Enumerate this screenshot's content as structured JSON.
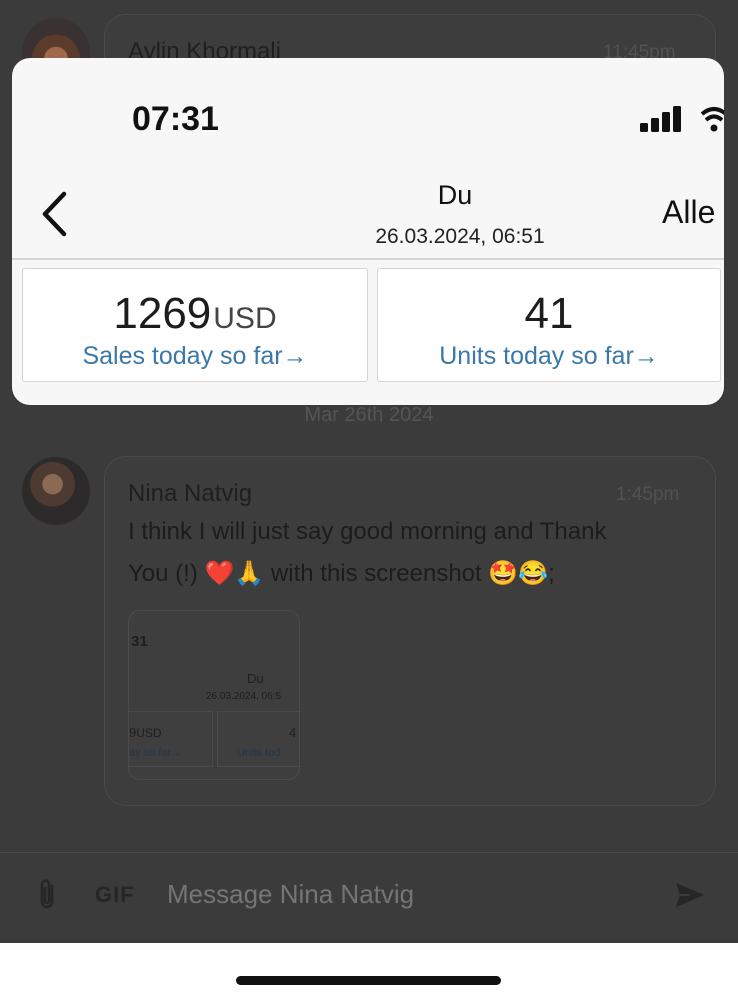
{
  "background_chat": {
    "top_message": {
      "sender": "Aylin Khormali",
      "time": "11:45pm"
    },
    "date_separator": "Mar 26th 2024",
    "message": {
      "sender": "Nina Natvig",
      "time": "1:45pm",
      "text_line1": "I think I will just say good morning and Thank",
      "text_line2": "You (!) ❤️🙏 with this screenshot 🤩😂;"
    },
    "thumbnail": {
      "time": "31",
      "title": "Du",
      "date": "26.03.2024, 06:5",
      "sales_value": "9",
      "sales_unit": "USD",
      "sales_label": "ay so far→",
      "units_value": "4",
      "units_label": "Units tod"
    },
    "composer": {
      "gif_label": "GIF",
      "placeholder": "Message Nina Natvig",
      "attach_icon": "paperclip-icon",
      "send_icon": "send-icon"
    }
  },
  "overlay_screenshot": {
    "status_time": "07:31",
    "title": "Du",
    "date": "26.03.2024, 06:51",
    "right_link": "Alle",
    "sales": {
      "value": "1269",
      "unit": "USD",
      "label": "Sales today so far→"
    },
    "units": {
      "value": "41",
      "label": "Units today so far→"
    }
  },
  "colors": {
    "link_blue": "#3a78a8",
    "dim_bg": "#3b3b3b"
  }
}
